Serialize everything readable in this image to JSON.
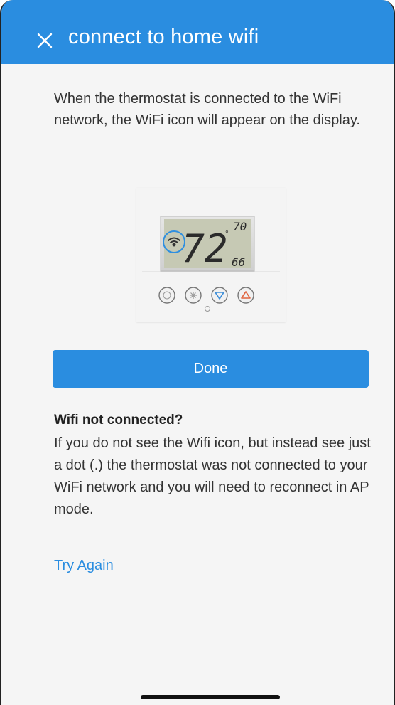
{
  "header": {
    "title": "connect to home wifi",
    "close_icon": "close-icon",
    "background_color": "#2a8de0"
  },
  "description": "When the thermostat is connected to the WiFi network, the WiFi icon will appear on the display.",
  "thermostat_display": {
    "main_temp": "72",
    "set_high": "70",
    "set_low": "66",
    "highlight_icon": "wifi-icon",
    "buttons": [
      "mode-button-icon",
      "fan-button-icon",
      "down-arrow-icon",
      "up-arrow-icon"
    ]
  },
  "done_button": {
    "label": "Done"
  },
  "help": {
    "title": "Wifi not connected?",
    "body": "If you do not see the Wifi icon, but instead see just a dot (.) the thermostat was not connected to your WiFi network and you will need to reconnect in AP mode.",
    "try_again_label": "Try Again",
    "link_color": "#2a8de0"
  }
}
